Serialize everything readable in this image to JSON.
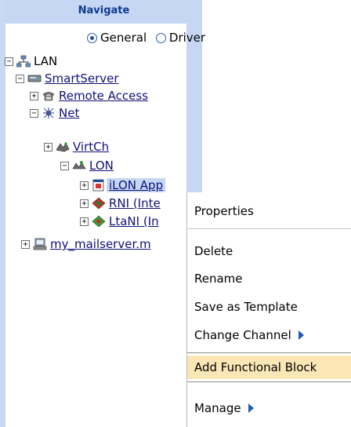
{
  "panel": {
    "title": "Navigate"
  },
  "view_mode": {
    "options": [
      {
        "label": "General",
        "selected": true
      },
      {
        "label": "Driver",
        "selected": false
      }
    ]
  },
  "tree": {
    "lan": "LAN",
    "smartserver": "SmartServer",
    "remote_access": "Remote Access",
    "net": "Net",
    "virtch": "VirtCh",
    "lon": "LON",
    "ilon_app": "iLON App",
    "rni": "RNI (Inte",
    "ltani": "LtaNI (In",
    "mailserver": "my_mailserver.m"
  },
  "context_menu": {
    "items": [
      {
        "label": "Properties"
      },
      {
        "label": "Delete"
      },
      {
        "label": "Rename"
      },
      {
        "label": "Save as Template"
      },
      {
        "label": "Change Channel",
        "submenu": true
      },
      {
        "label": "Add Functional Block",
        "highlighted": true
      },
      {
        "label": "Manage",
        "submenu": true
      }
    ]
  },
  "colors": {
    "header_bg": "#c5d7f3",
    "header_text": "#0f3a8f",
    "menu_highlight": "#fae7b5",
    "submenu_arrow": "#1e5bbd"
  }
}
